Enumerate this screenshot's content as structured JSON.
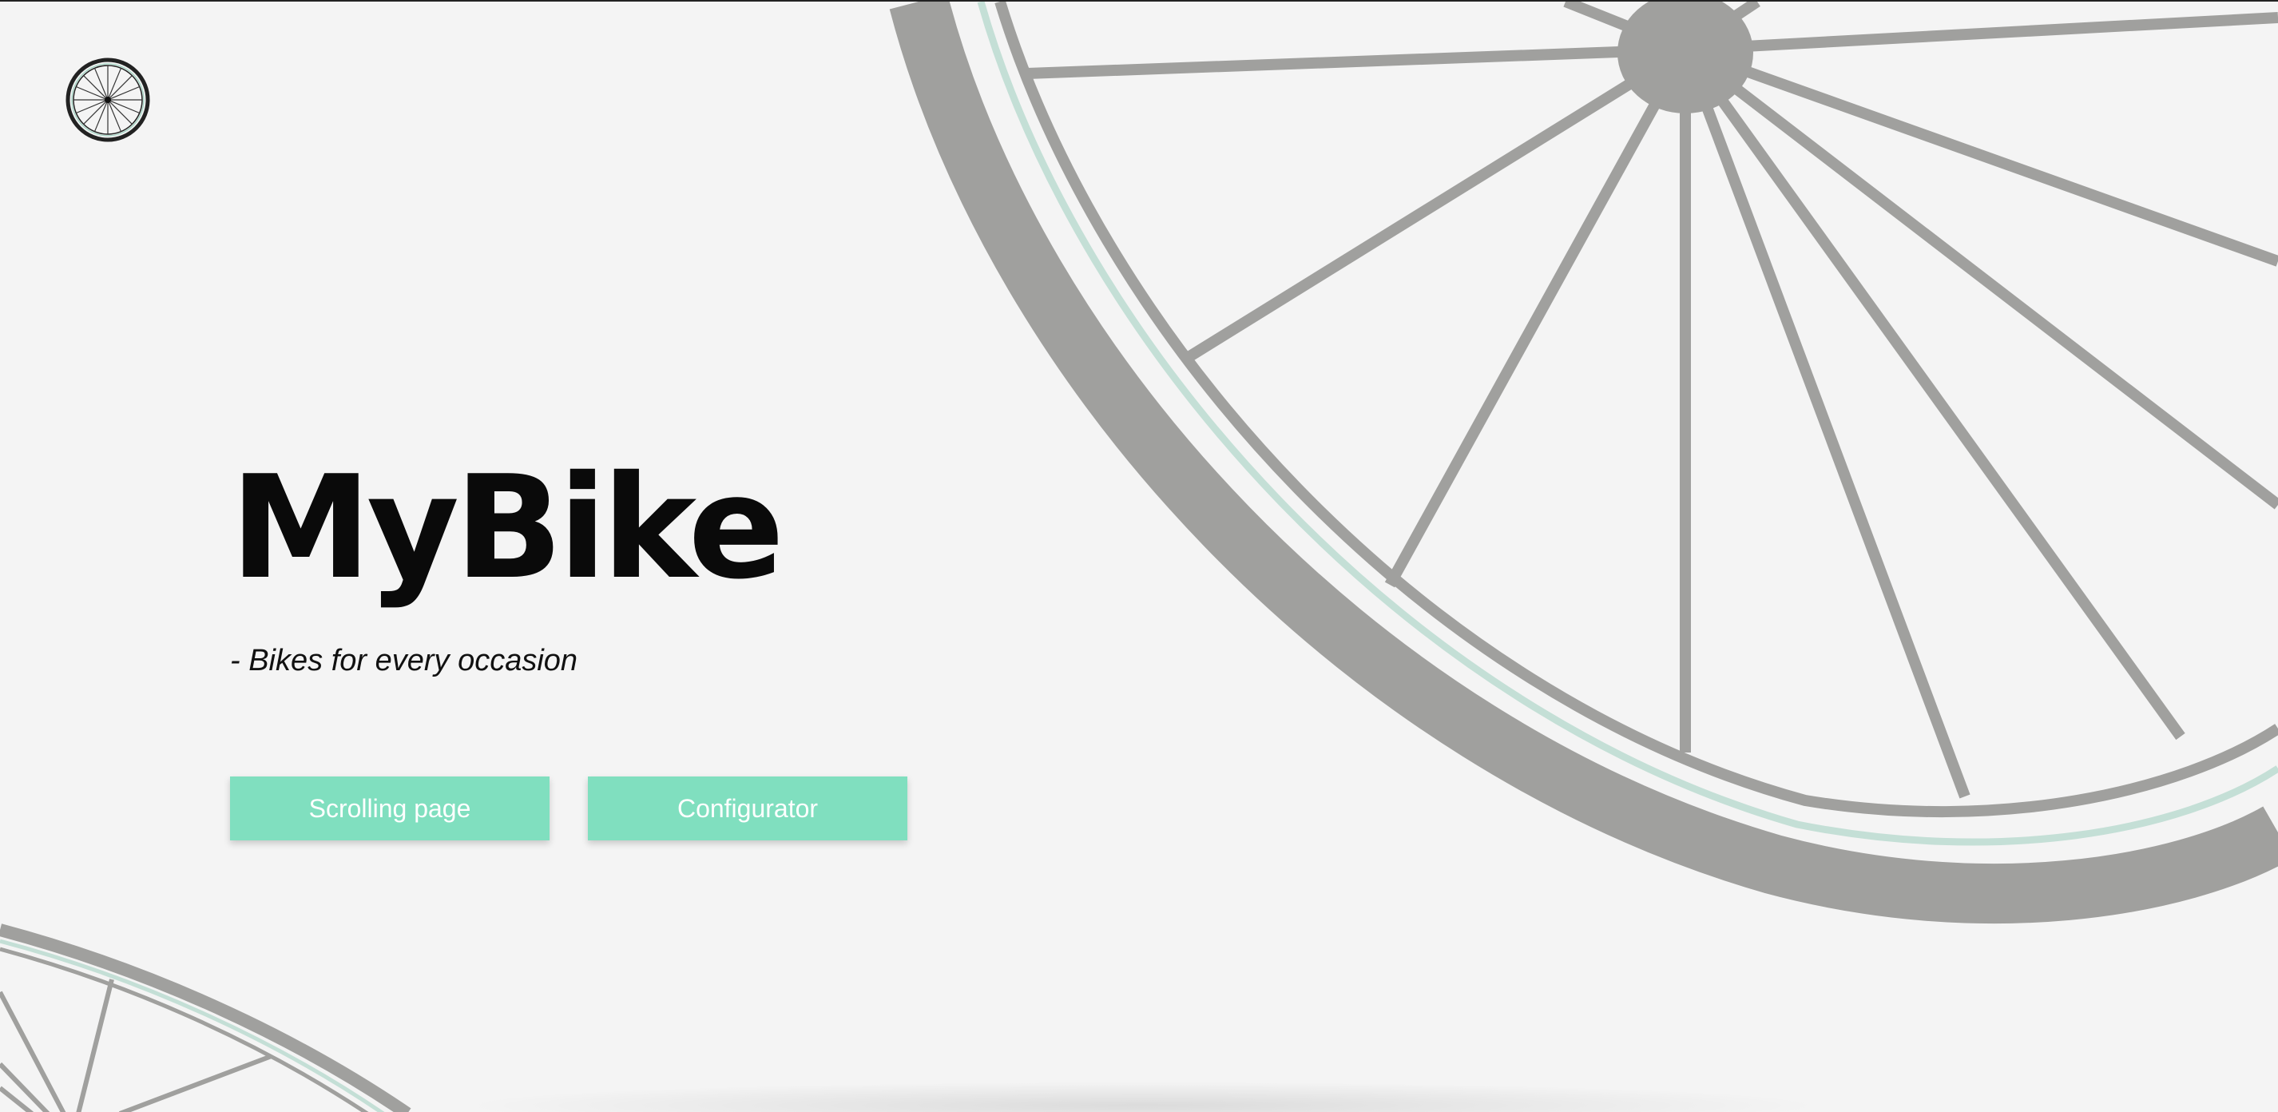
{
  "brand": {
    "logo_icon": "bicycle-wheel-icon"
  },
  "hero": {
    "title": "MyBike",
    "tagline": "- Bikes for every occasion"
  },
  "actions": {
    "scrolling_page_label": "Scrolling page",
    "configurator_label": "Configurator"
  },
  "theme": {
    "accent": "#80dfbf",
    "wheel_gray": "#a0a09e",
    "rim_stripe": "#c4dfd6",
    "background": "#f4f4f4"
  }
}
